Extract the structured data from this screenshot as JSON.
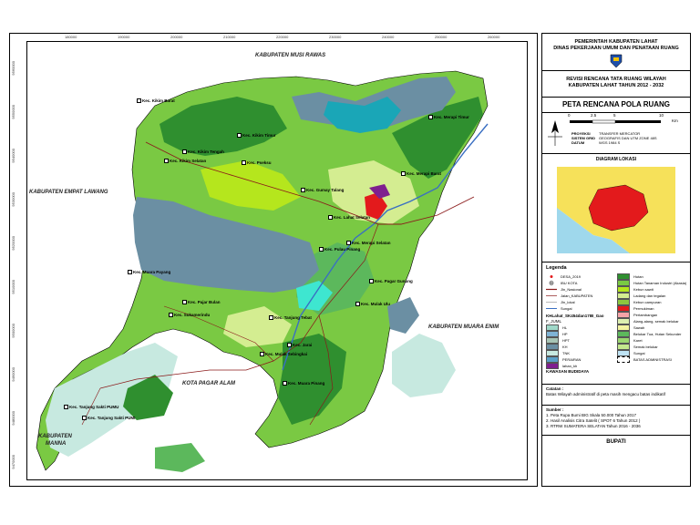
{
  "map": {
    "top_coords": [
      "180000",
      "190000",
      "200000",
      "210000",
      "220000",
      "230000",
      "240000",
      "250000",
      "260000"
    ],
    "left_coords": [
      "9560000",
      "9550000",
      "9540000",
      "9530000",
      "9520000",
      "9510000",
      "9500000",
      "9490000",
      "9480000",
      "9470000"
    ],
    "regions": {
      "north": "KABUPATEN MUSI RAWAS",
      "west": "KABUPATEN EMPAT LAWANG",
      "east": "KABUPATEN MUARA ENIM",
      "south": "KOTA PAGAR ALAM",
      "southwest_1": "KABUPATEN",
      "southwest_2": "MANNA"
    },
    "places": [
      "Kec. Kikim Barat",
      "Kec. Kikim Timur",
      "Kec. Kikim Tengah",
      "Kec. Kikim Selatan",
      "Kec. Pseksu",
      "Kec. Gumay Talang",
      "Kec. Merapi Timur",
      "Kec. Merapi Barat",
      "Kec. Lahat Selatan",
      "Kec. Pulau Pinang",
      "Kec. Merapi Selatan",
      "Kec. Muara Payang",
      "Kec. Pagar Gunung",
      "Kec. Mulak Ulu",
      "Kec. Pajar Bulan",
      "Kec. Sukamerindu",
      "Kec. Tanjung Tebat",
      "Kec. Mulak Sebingkai",
      "Kec. Jarai",
      "Kec. Muara Pinang",
      "Kec. Tanjung Sakti PUMU",
      "Kec. Tanjung Sakti PUMI"
    ]
  },
  "panel": {
    "header": {
      "line1": "PEMERINTAH KABUPATEN LAHAT",
      "line2": "DINAS PEKERJAAN UMUM DAN PENATAAN RUANG"
    },
    "subtitle": {
      "line1": "REVISI RENCANA TATA RUANG WILAYAH",
      "line2": "KABUPATEN LAHAT TAHUN 2012 - 2032"
    },
    "map_title": "PETA RENCANA POLA RUANG",
    "scale": {
      "ticks": [
        "0",
        "2.5",
        "5",
        "10"
      ],
      "unit": "Km"
    },
    "projection": {
      "labels": [
        "PROYEKSI",
        "SISTEM GRID",
        "DATUM"
      ],
      "values": [
        "TRANSFER MERCATOR",
        "GEOGRAFIS DAN UTM ZONE 48S",
        "WGS 1984 S"
      ]
    },
    "diagram_title": "DIAGRAM LOKASI",
    "legend_title": "Legenda",
    "legend_left": [
      "DESA_2019",
      "IBU KOTA",
      "Jln_Nasional",
      "Jalan_KABUPATEN",
      "Jln_lokal",
      "Sungai"
    ],
    "legend_left_heading": "KHLahat_SK454dan17IB_Gao",
    "legend_left_sub": "F_JUML",
    "legend_forest": [
      {
        "label": "HL",
        "color": "#9fd8c8"
      },
      {
        "label": "HP",
        "color": "#7fb3d5"
      },
      {
        "label": "HPT",
        "color": "#a7c4b5"
      },
      {
        "label": "KH",
        "color": "#6b8fa3"
      },
      {
        "label": "TNK",
        "color": "#c7e9e0"
      },
      {
        "label": "PERAIRAN",
        "color": "#5aa0c8"
      },
      {
        "label": "lahan_kh",
        "color": "#7f1f8f"
      }
    ],
    "legend_right": [
      {
        "label": "Hutan",
        "color": "#2f8f2f"
      },
      {
        "label": "Hutan Tanaman Industri (Akasia)",
        "color": "#7ac943"
      },
      {
        "label": "Kebun sawit",
        "color": "#b5e61d"
      },
      {
        "label": "Ladang dan tegalan",
        "color": "#d4ed91"
      },
      {
        "label": "Kebun campuran",
        "color": "#8cc63f"
      },
      {
        "label": "Permukiman",
        "color": "#e31a1c"
      },
      {
        "label": "Pertambangan",
        "color": "#f4a3a8"
      },
      {
        "label": "Alang-alang, semak belukar",
        "color": "#ddefb0"
      },
      {
        "label": "Sawah",
        "color": "#f3f3a0"
      },
      {
        "label": "Belukar Tua, Hutan Sekunder",
        "color": "#5cb85c"
      },
      {
        "label": "Karet",
        "color": "#9bd770"
      },
      {
        "label": "Semak belukar",
        "color": "#c3e88d"
      },
      {
        "label": "Sungai",
        "color": "#bfe4f5"
      }
    ],
    "batas": "BATAS ADMINISTRASI",
    "kawasan": "KAWASAN BUDIDAYA",
    "catatan_title": "Catatan :",
    "catatan": "Batas Wilayah administratif di peta masih mengacu batas indikatif",
    "sumber_title": "Sumber :",
    "sumber": [
      "1. Peta Rupa Bumi BIG Skala 50.000  Tahun 2017",
      "2. Hasil Analisis Citra Satelit ( SPOT 6 Tahun 2012 )",
      "3. RTRW SUMATERA SELATAN Tahun 2016 - 2036"
    ],
    "bupati": "BUPATI"
  },
  "colors": {
    "forest_dark": "#2f8f2f",
    "green_mid": "#7ac943",
    "green_light": "#b5e61d",
    "teal_reserve": "#6b8fa3",
    "protect": "#c7e9e0",
    "water": "#1aa6b7",
    "settle": "#e31a1c",
    "road": "#8b1a1a"
  }
}
